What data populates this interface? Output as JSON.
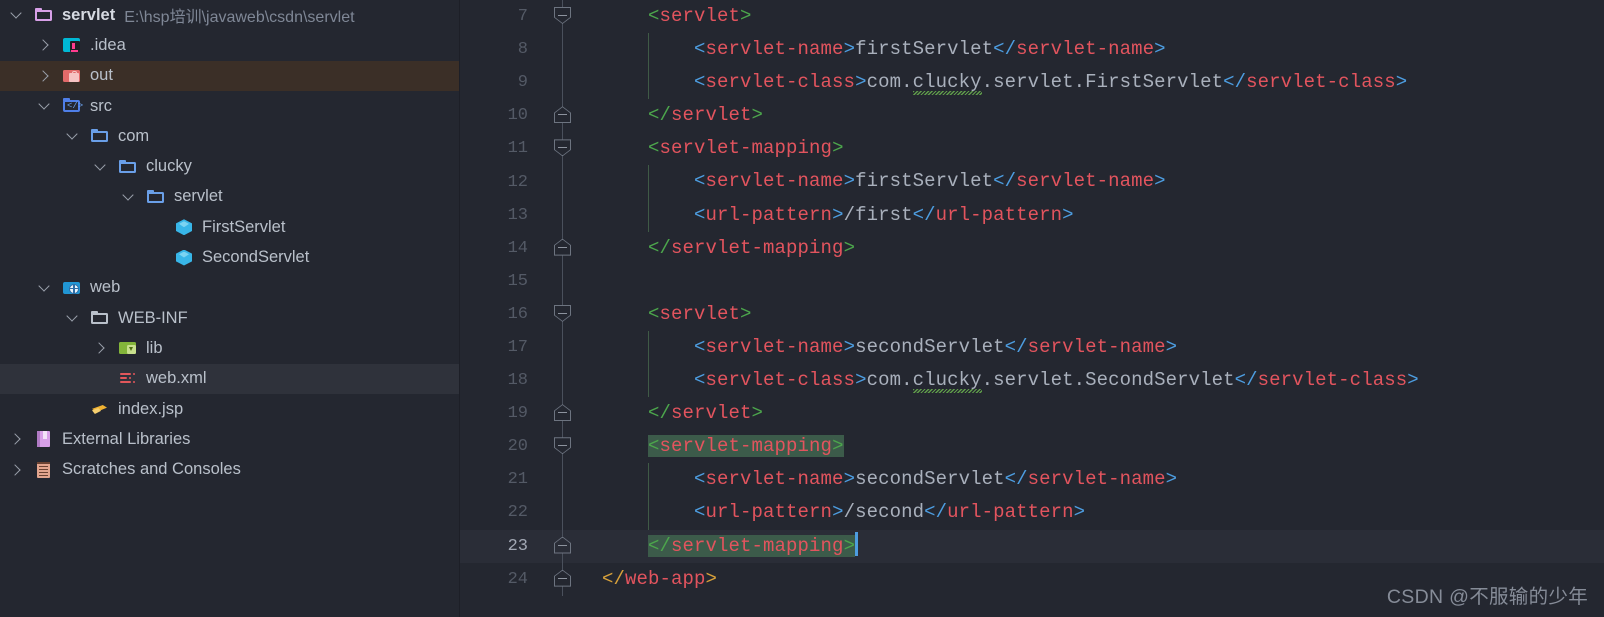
{
  "window": {
    "theme": "darcula",
    "colors": {
      "background": "#242730",
      "sidebar_bg": "#242730",
      "selected_row": "#3b2f27",
      "focused_row": "#2f323b",
      "caret_line": "#2a2d37",
      "tag_name": "#e2545e",
      "bracket_blue": "#4d9de0",
      "bracket_green": "#4ca64c",
      "bracket_orange": "#d8a13a",
      "text_value": "#a9b0bc",
      "match_highlight": "#3c5b4a",
      "indent_guide": "#3f5a46",
      "line_number": "#545a66"
    }
  },
  "sidebar": {
    "items": [
      {
        "label": "servlet",
        "path": "E:\\hsp培训\\javaweb\\csdn\\servlet",
        "icon": "folder-module-icon",
        "indent": 0,
        "twisty": "open",
        "bold": true,
        "state": "normal"
      },
      {
        "label": ".idea",
        "path": "",
        "icon": "idea-folder-icon",
        "indent": 1,
        "twisty": "closed",
        "bold": false,
        "state": "normal"
      },
      {
        "label": "out",
        "path": "",
        "icon": "out-folder-icon",
        "indent": 1,
        "twisty": "closed",
        "bold": false,
        "state": "selected"
      },
      {
        "label": "src",
        "path": "",
        "icon": "source-folder-icon",
        "indent": 1,
        "twisty": "open",
        "bold": false,
        "state": "normal"
      },
      {
        "label": "com",
        "path": "",
        "icon": "folder-icon",
        "indent": 2,
        "twisty": "open",
        "bold": false,
        "state": "normal"
      },
      {
        "label": "clucky",
        "path": "",
        "icon": "folder-icon",
        "indent": 3,
        "twisty": "open",
        "bold": false,
        "state": "normal"
      },
      {
        "label": "servlet",
        "path": "",
        "icon": "folder-icon",
        "indent": 4,
        "twisty": "open",
        "bold": false,
        "state": "normal"
      },
      {
        "label": "FirstServlet",
        "path": "",
        "icon": "java-class-icon",
        "indent": 5,
        "twisty": "none",
        "bold": false,
        "state": "normal"
      },
      {
        "label": "SecondServlet",
        "path": "",
        "icon": "java-class-icon",
        "indent": 5,
        "twisty": "none",
        "bold": false,
        "state": "normal"
      },
      {
        "label": "web",
        "path": "",
        "icon": "web-folder-icon",
        "indent": 1,
        "twisty": "open",
        "bold": false,
        "state": "normal"
      },
      {
        "label": "WEB-INF",
        "path": "",
        "icon": "folder-plain-icon",
        "indent": 2,
        "twisty": "open",
        "bold": false,
        "state": "normal"
      },
      {
        "label": "lib",
        "path": "",
        "icon": "lib-folder-icon",
        "indent": 3,
        "twisty": "closed",
        "bold": false,
        "state": "normal"
      },
      {
        "label": "web.xml",
        "path": "",
        "icon": "xml-file-icon",
        "indent": 3,
        "twisty": "none",
        "bold": false,
        "state": "focused"
      },
      {
        "label": "index.jsp",
        "path": "",
        "icon": "jsp-file-icon",
        "indent": 2,
        "twisty": "none",
        "bold": false,
        "state": "normal"
      },
      {
        "label": "External Libraries",
        "path": "",
        "icon": "external-libraries-icon",
        "indent": 0,
        "twisty": "closed",
        "bold": false,
        "state": "normal"
      },
      {
        "label": "Scratches and Consoles",
        "path": "",
        "icon": "scratches-icon",
        "indent": 0,
        "twisty": "closed",
        "bold": false,
        "state": "normal"
      }
    ]
  },
  "editor": {
    "file": "web.xml",
    "first_visible_line": 7,
    "caret_line": 23,
    "lines": [
      {
        "n": 7,
        "fold": "down",
        "fold_line": false,
        "indent_guides": [],
        "tokens": [
          {
            "t": "sp",
            "v": "    "
          },
          {
            "t": "g",
            "v": "<"
          },
          {
            "t": "tag",
            "v": "servlet"
          },
          {
            "t": "g",
            "v": ">"
          }
        ]
      },
      {
        "n": 8,
        "fold": "none",
        "fold_line": true,
        "indent_guides": [
          1
        ],
        "tokens": [
          {
            "t": "sp",
            "v": "        "
          },
          {
            "t": "b",
            "v": "<"
          },
          {
            "t": "tag",
            "v": "servlet-name"
          },
          {
            "t": "b",
            "v": ">"
          },
          {
            "t": "x",
            "v": "firstServlet"
          },
          {
            "t": "b",
            "v": "</"
          },
          {
            "t": "tag",
            "v": "servlet-name"
          },
          {
            "t": "b",
            "v": ">"
          }
        ]
      },
      {
        "n": 9,
        "fold": "none",
        "fold_line": true,
        "indent_guides": [
          1
        ],
        "tokens": [
          {
            "t": "sp",
            "v": "        "
          },
          {
            "t": "b",
            "v": "<"
          },
          {
            "t": "tag",
            "v": "servlet-class"
          },
          {
            "t": "b",
            "v": ">"
          },
          {
            "t": "x",
            "v": "com."
          },
          {
            "t": "xs",
            "v": "clucky"
          },
          {
            "t": "x",
            "v": ".servlet.FirstServlet"
          },
          {
            "t": "b",
            "v": "</"
          },
          {
            "t": "tag",
            "v": "servlet-class"
          },
          {
            "t": "b",
            "v": ">"
          }
        ]
      },
      {
        "n": 10,
        "fold": "up",
        "fold_line": false,
        "indent_guides": [],
        "tokens": [
          {
            "t": "sp",
            "v": "    "
          },
          {
            "t": "g",
            "v": "</"
          },
          {
            "t": "tag",
            "v": "servlet"
          },
          {
            "t": "g",
            "v": ">"
          }
        ]
      },
      {
        "n": 11,
        "fold": "down",
        "fold_line": false,
        "indent_guides": [],
        "tokens": [
          {
            "t": "sp",
            "v": "    "
          },
          {
            "t": "g",
            "v": "<"
          },
          {
            "t": "tag",
            "v": "servlet-mapping"
          },
          {
            "t": "g",
            "v": ">"
          }
        ]
      },
      {
        "n": 12,
        "fold": "none",
        "fold_line": true,
        "indent_guides": [
          1
        ],
        "tokens": [
          {
            "t": "sp",
            "v": "        "
          },
          {
            "t": "b",
            "v": "<"
          },
          {
            "t": "tag",
            "v": "servlet-name"
          },
          {
            "t": "b",
            "v": ">"
          },
          {
            "t": "x",
            "v": "firstServlet"
          },
          {
            "t": "b",
            "v": "</"
          },
          {
            "t": "tag",
            "v": "servlet-name"
          },
          {
            "t": "b",
            "v": ">"
          }
        ]
      },
      {
        "n": 13,
        "fold": "none",
        "fold_line": true,
        "indent_guides": [
          1
        ],
        "tokens": [
          {
            "t": "sp",
            "v": "        "
          },
          {
            "t": "b",
            "v": "<"
          },
          {
            "t": "tag",
            "v": "url-pattern"
          },
          {
            "t": "b",
            "v": ">"
          },
          {
            "t": "x",
            "v": "/first"
          },
          {
            "t": "b",
            "v": "</"
          },
          {
            "t": "tag",
            "v": "url-pattern"
          },
          {
            "t": "b",
            "v": ">"
          }
        ]
      },
      {
        "n": 14,
        "fold": "up",
        "fold_line": false,
        "indent_guides": [],
        "tokens": [
          {
            "t": "sp",
            "v": "    "
          },
          {
            "t": "g",
            "v": "</"
          },
          {
            "t": "tag",
            "v": "servlet-mapping"
          },
          {
            "t": "g",
            "v": ">"
          }
        ]
      },
      {
        "n": 15,
        "fold": "none",
        "fold_line": false,
        "indent_guides": [],
        "tokens": []
      },
      {
        "n": 16,
        "fold": "down",
        "fold_line": false,
        "indent_guides": [],
        "tokens": [
          {
            "t": "sp",
            "v": "    "
          },
          {
            "t": "g",
            "v": "<"
          },
          {
            "t": "tag",
            "v": "servlet"
          },
          {
            "t": "g",
            "v": ">"
          }
        ]
      },
      {
        "n": 17,
        "fold": "none",
        "fold_line": true,
        "indent_guides": [
          1
        ],
        "tokens": [
          {
            "t": "sp",
            "v": "        "
          },
          {
            "t": "b",
            "v": "<"
          },
          {
            "t": "tag",
            "v": "servlet-name"
          },
          {
            "t": "b",
            "v": ">"
          },
          {
            "t": "x",
            "v": "secondServlet"
          },
          {
            "t": "b",
            "v": "</"
          },
          {
            "t": "tag",
            "v": "servlet-name"
          },
          {
            "t": "b",
            "v": ">"
          }
        ]
      },
      {
        "n": 18,
        "fold": "none",
        "fold_line": true,
        "indent_guides": [
          1
        ],
        "tokens": [
          {
            "t": "sp",
            "v": "        "
          },
          {
            "t": "b",
            "v": "<"
          },
          {
            "t": "tag",
            "v": "servlet-class"
          },
          {
            "t": "b",
            "v": ">"
          },
          {
            "t": "x",
            "v": "com."
          },
          {
            "t": "xs",
            "v": "clucky"
          },
          {
            "t": "x",
            "v": ".servlet.SecondServlet"
          },
          {
            "t": "b",
            "v": "</"
          },
          {
            "t": "tag",
            "v": "servlet-class"
          },
          {
            "t": "b",
            "v": ">"
          }
        ]
      },
      {
        "n": 19,
        "fold": "up",
        "fold_line": false,
        "indent_guides": [],
        "tokens": [
          {
            "t": "sp",
            "v": "    "
          },
          {
            "t": "g",
            "v": "</"
          },
          {
            "t": "tag",
            "v": "servlet"
          },
          {
            "t": "g",
            "v": ">"
          }
        ]
      },
      {
        "n": 20,
        "fold": "down",
        "fold_line": false,
        "indent_guides": [],
        "tokens": [
          {
            "t": "sp",
            "v": "    "
          },
          {
            "t": "mg",
            "v": "<"
          },
          {
            "t": "mtag",
            "v": "servlet-mapping"
          },
          {
            "t": "mg",
            "v": ">"
          }
        ]
      },
      {
        "n": 21,
        "fold": "none",
        "fold_line": true,
        "indent_guides": [
          1
        ],
        "tokens": [
          {
            "t": "sp",
            "v": "        "
          },
          {
            "t": "b",
            "v": "<"
          },
          {
            "t": "tag",
            "v": "servlet-name"
          },
          {
            "t": "b",
            "v": ">"
          },
          {
            "t": "x",
            "v": "secondServlet"
          },
          {
            "t": "b",
            "v": "</"
          },
          {
            "t": "tag",
            "v": "servlet-name"
          },
          {
            "t": "b",
            "v": ">"
          }
        ]
      },
      {
        "n": 22,
        "fold": "none",
        "fold_line": true,
        "indent_guides": [
          1
        ],
        "tokens": [
          {
            "t": "sp",
            "v": "        "
          },
          {
            "t": "b",
            "v": "<"
          },
          {
            "t": "tag",
            "v": "url-pattern"
          },
          {
            "t": "b",
            "v": ">"
          },
          {
            "t": "x",
            "v": "/second"
          },
          {
            "t": "b",
            "v": "</"
          },
          {
            "t": "tag",
            "v": "url-pattern"
          },
          {
            "t": "b",
            "v": ">"
          }
        ]
      },
      {
        "n": 23,
        "fold": "up",
        "fold_line": false,
        "indent_guides": [],
        "caret": true,
        "tokens": [
          {
            "t": "sp",
            "v": "    "
          },
          {
            "t": "mg",
            "v": "</"
          },
          {
            "t": "mtag",
            "v": "servlet-mapping"
          },
          {
            "t": "mg",
            "v": ">"
          },
          {
            "t": "caret",
            "v": ""
          }
        ]
      },
      {
        "n": 24,
        "fold": "up",
        "fold_line": false,
        "indent_guides": [],
        "tokens": [
          {
            "t": "o",
            "v": "</"
          },
          {
            "t": "tag",
            "v": "web-app"
          },
          {
            "t": "o",
            "v": ">"
          }
        ]
      }
    ]
  },
  "watermark": {
    "text": "CSDN @不服输的少年"
  }
}
